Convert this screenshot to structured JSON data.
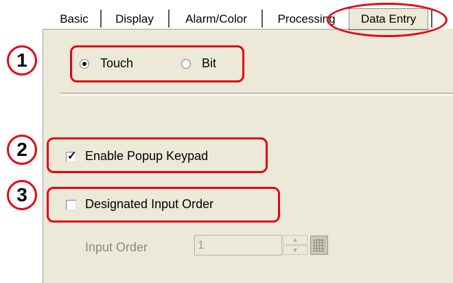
{
  "tabs": [
    {
      "label": "Basic"
    },
    {
      "label": "Display"
    },
    {
      "label": "Alarm/Color"
    },
    {
      "label": "Processing"
    },
    {
      "label": "Data Entry",
      "active": true
    }
  ],
  "callouts": [
    "1",
    "2",
    "3"
  ],
  "input_mode": {
    "options": [
      {
        "label": "Touch",
        "selected": true
      },
      {
        "label": "Bit",
        "selected": false
      }
    ]
  },
  "enable_popup_keypad": {
    "label": "Enable Popup Keypad",
    "checked": true
  },
  "designated_input_order": {
    "label": "Designated Input Order",
    "checked": false
  },
  "input_order": {
    "label": "Input Order",
    "value": "1",
    "enabled": false
  },
  "colors": {
    "highlight": "#e60012",
    "panel": "#ece9d8"
  }
}
